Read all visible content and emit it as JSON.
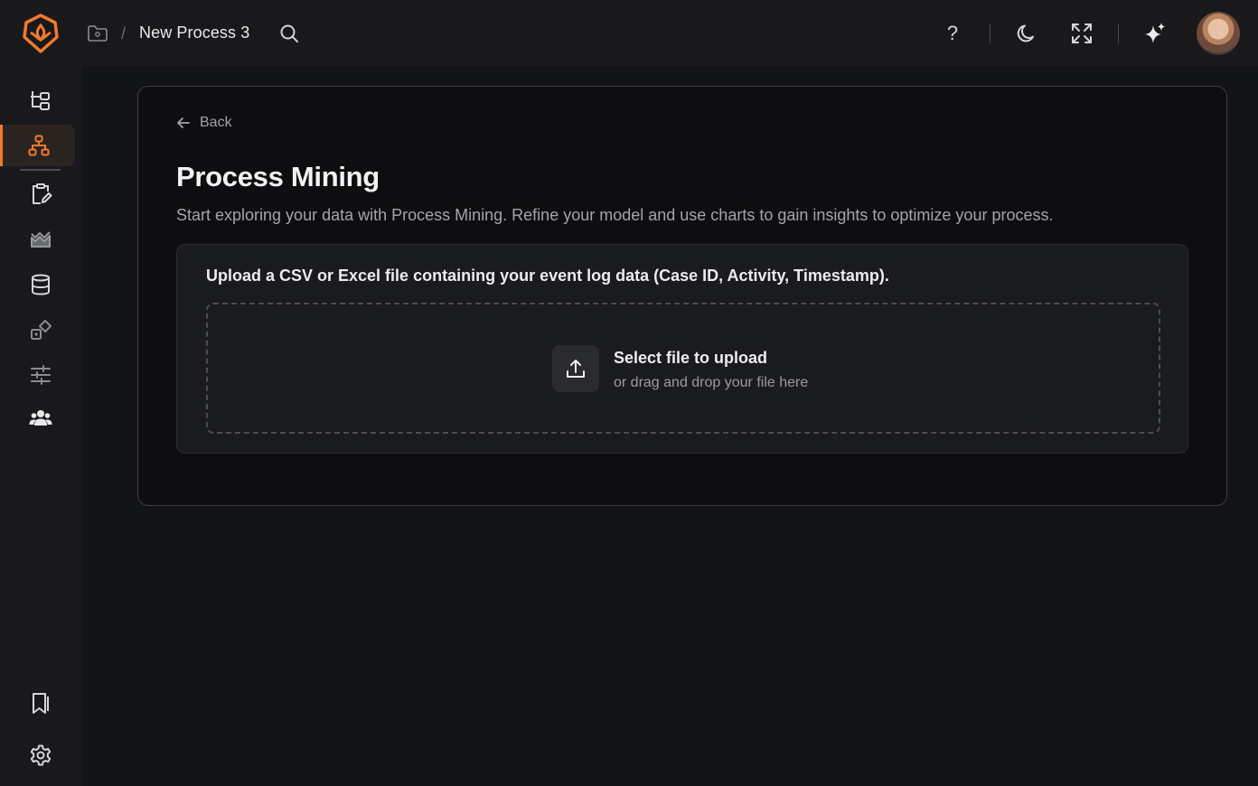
{
  "header": {
    "breadcrumb_separator": "/",
    "process_title": "New Process 3",
    "help_label": "?"
  },
  "sidebar": {
    "items": [
      {
        "icon": "tree-structure-icon"
      },
      {
        "icon": "hierarchy-icon",
        "active": true
      },
      {
        "icon": "clipboard-edit-icon"
      },
      {
        "icon": "mountain-chart-icon"
      },
      {
        "icon": "database-icon"
      },
      {
        "icon": "shapes-icon"
      },
      {
        "icon": "sliders-icon"
      },
      {
        "icon": "users-icon"
      }
    ],
    "bottom_items": [
      {
        "icon": "bookmarks-icon"
      },
      {
        "icon": "gear-icon"
      }
    ]
  },
  "main": {
    "back_label": "Back",
    "title": "Process Mining",
    "description": "Start exploring your data with Process Mining. Refine your model and use charts to gain insights to optimize your process.",
    "upload": {
      "instruction": "Upload a CSV or Excel file containing your event log data (Case ID, Activity, Timestamp).",
      "select_label": "Select file to upload",
      "drag_label": "or drag and drop your file here"
    }
  },
  "colors": {
    "accent": "#f07a2c",
    "background": "#131417",
    "card": "#0e0e10"
  }
}
